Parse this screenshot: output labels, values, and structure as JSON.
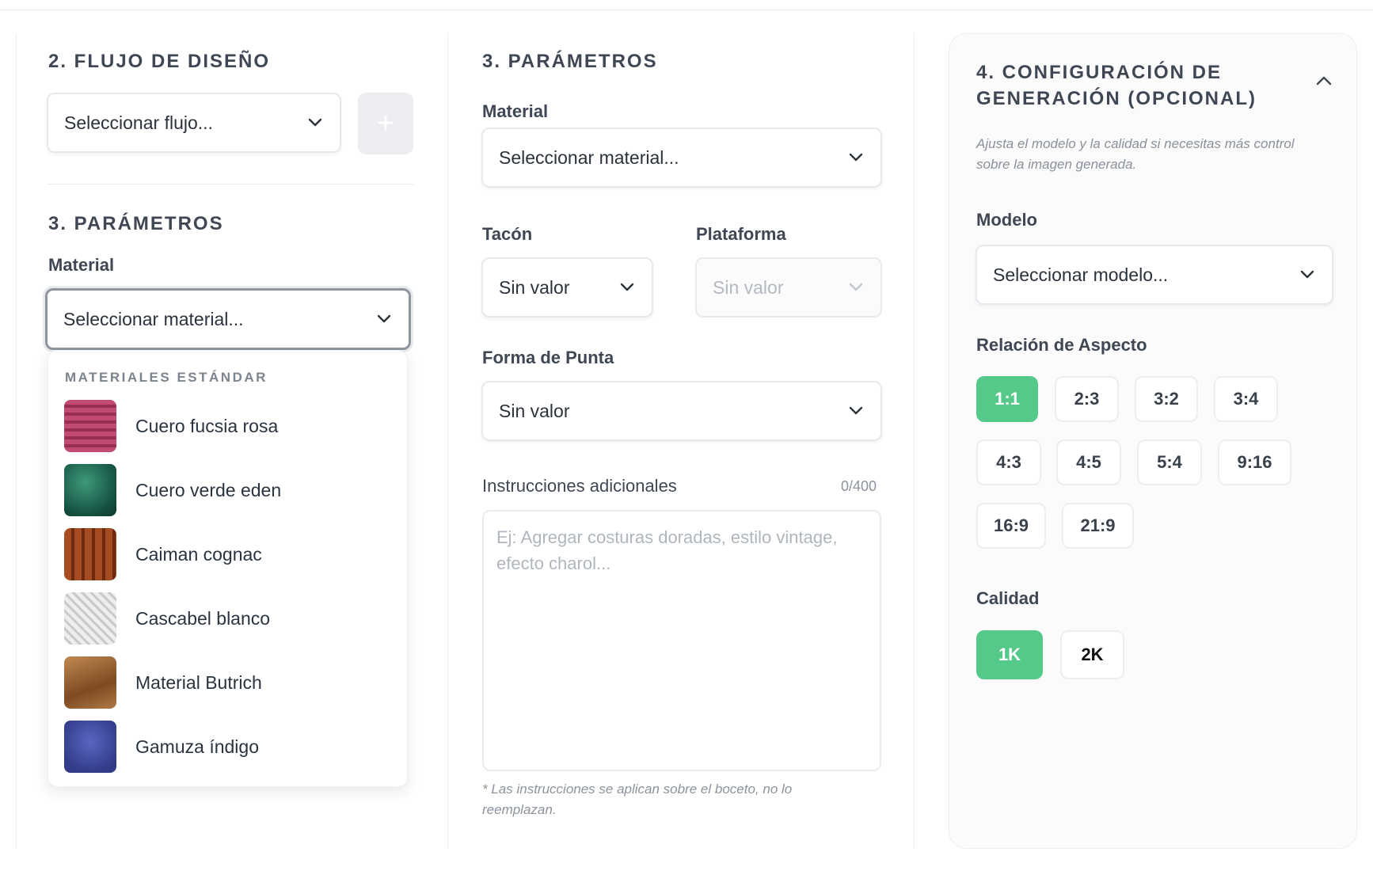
{
  "flow": {
    "section_title": "2. FLUJO DE DISEÑO",
    "select_value": "Seleccionar flujo...",
    "add_label": "+"
  },
  "params_left": {
    "section_title": "3. PARÁMETROS",
    "material_label": "Material",
    "material_value": "Seleccionar material..."
  },
  "dropdown": {
    "group_title": "MATERIALES ESTÁNDAR",
    "items": [
      {
        "label": "Cuero fucsia rosa",
        "color": "#b23d63"
      },
      {
        "label": "Cuero verde eden",
        "color": "#1f6b55"
      },
      {
        "label": "Caiman cognac",
        "color": "#8e3e1c"
      },
      {
        "label": "Cascabel blanco",
        "color": "#d9d9d9"
      },
      {
        "label": "Material Butrich",
        "color": "#9a6232"
      },
      {
        "label": "Gamuza índigo",
        "color": "#3f4aa0"
      }
    ]
  },
  "params_mid": {
    "section_title": "3. PARÁMETROS",
    "material_label": "Material",
    "material_value": "Seleccionar material...",
    "heel_label": "Tacón",
    "heel_value": "Sin valor",
    "platform_label": "Plataforma",
    "platform_value": "Sin valor",
    "toe_label": "Forma de Punta",
    "toe_value": "Sin valor",
    "instructions_label": "Instrucciones adicionales",
    "instructions_counter": "0/400",
    "instructions_placeholder": "Ej: Agregar costuras doradas, estilo vintage, efecto charol...",
    "note": "* Las instrucciones se aplican sobre el boceto, no lo reemplazan."
  },
  "config": {
    "section_title": "4. CONFIGURACIÓN DE GENERACIÓN (OPCIONAL)",
    "description": "Ajusta el modelo y la calidad si necesitas más control sobre la imagen generada.",
    "model_label": "Modelo",
    "model_value": "Seleccionar modelo...",
    "aspect_label": "Relación de Aspecto",
    "aspect_options": [
      "1:1",
      "2:3",
      "3:2",
      "3:4",
      "4:3",
      "4:5",
      "5:4",
      "9:16",
      "16:9",
      "21:9"
    ],
    "aspect_selected": "1:1",
    "quality_label": "Calidad",
    "quality_options": [
      "1K",
      "2K"
    ],
    "quality_selected": "1K",
    "accent_color": "#55c98a"
  }
}
